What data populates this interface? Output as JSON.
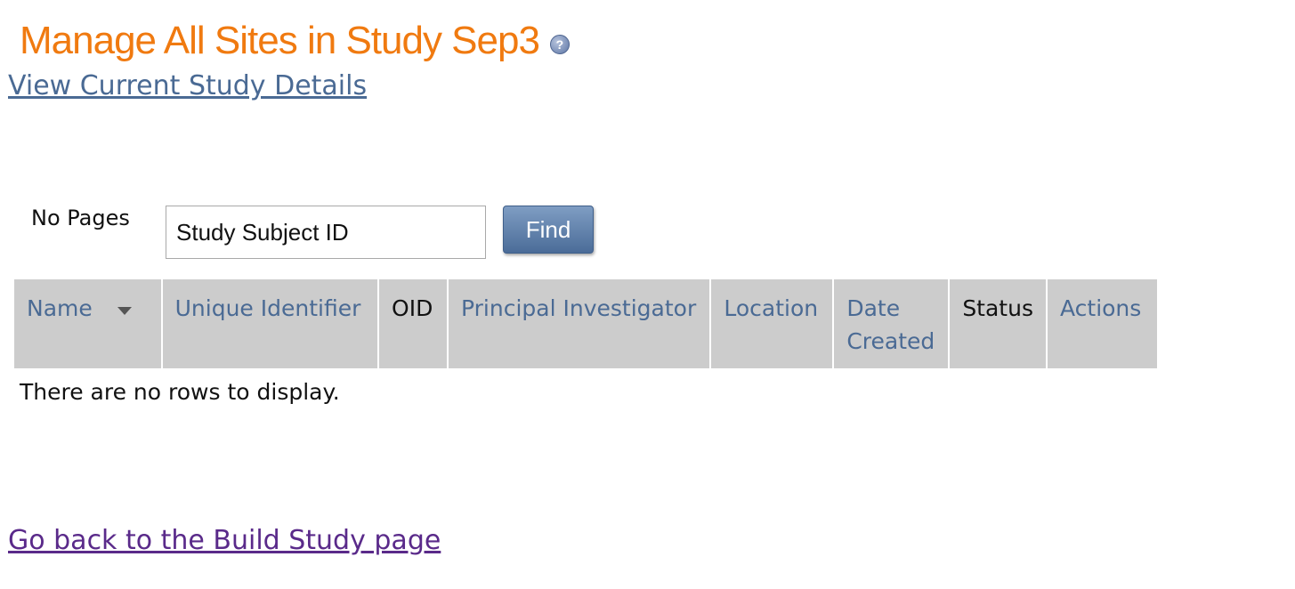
{
  "header": {
    "title": "Manage All Sites in Study Sep3",
    "help_icon": "question-circle-icon"
  },
  "links": {
    "view_study": "View Current Study Details",
    "go_back": "Go back to the Build Study page"
  },
  "toolbar": {
    "paging_label": "No Pages",
    "search_placeholder": "Study Subject ID",
    "find_label": "Find"
  },
  "table": {
    "columns": [
      {
        "label": "Name",
        "sortable": true
      },
      {
        "label": "Unique Identifier",
        "sortable": true
      },
      {
        "label": "OID",
        "sortable": false
      },
      {
        "label": "Principal Investigator",
        "sortable": true
      },
      {
        "label": "Location",
        "sortable": true
      },
      {
        "label": "Date Created",
        "sortable": true
      },
      {
        "label": "Status",
        "sortable": false
      },
      {
        "label": "Actions",
        "sortable": true
      }
    ],
    "sort_icon": "sort-descending-icon",
    "empty_message": "There are no rows to display."
  },
  "colors": {
    "title": "#f07a10",
    "link": "#4a6a94",
    "visited_link": "#5a2a8a",
    "header_bg": "#cccccc",
    "button": "#4b6c98"
  }
}
